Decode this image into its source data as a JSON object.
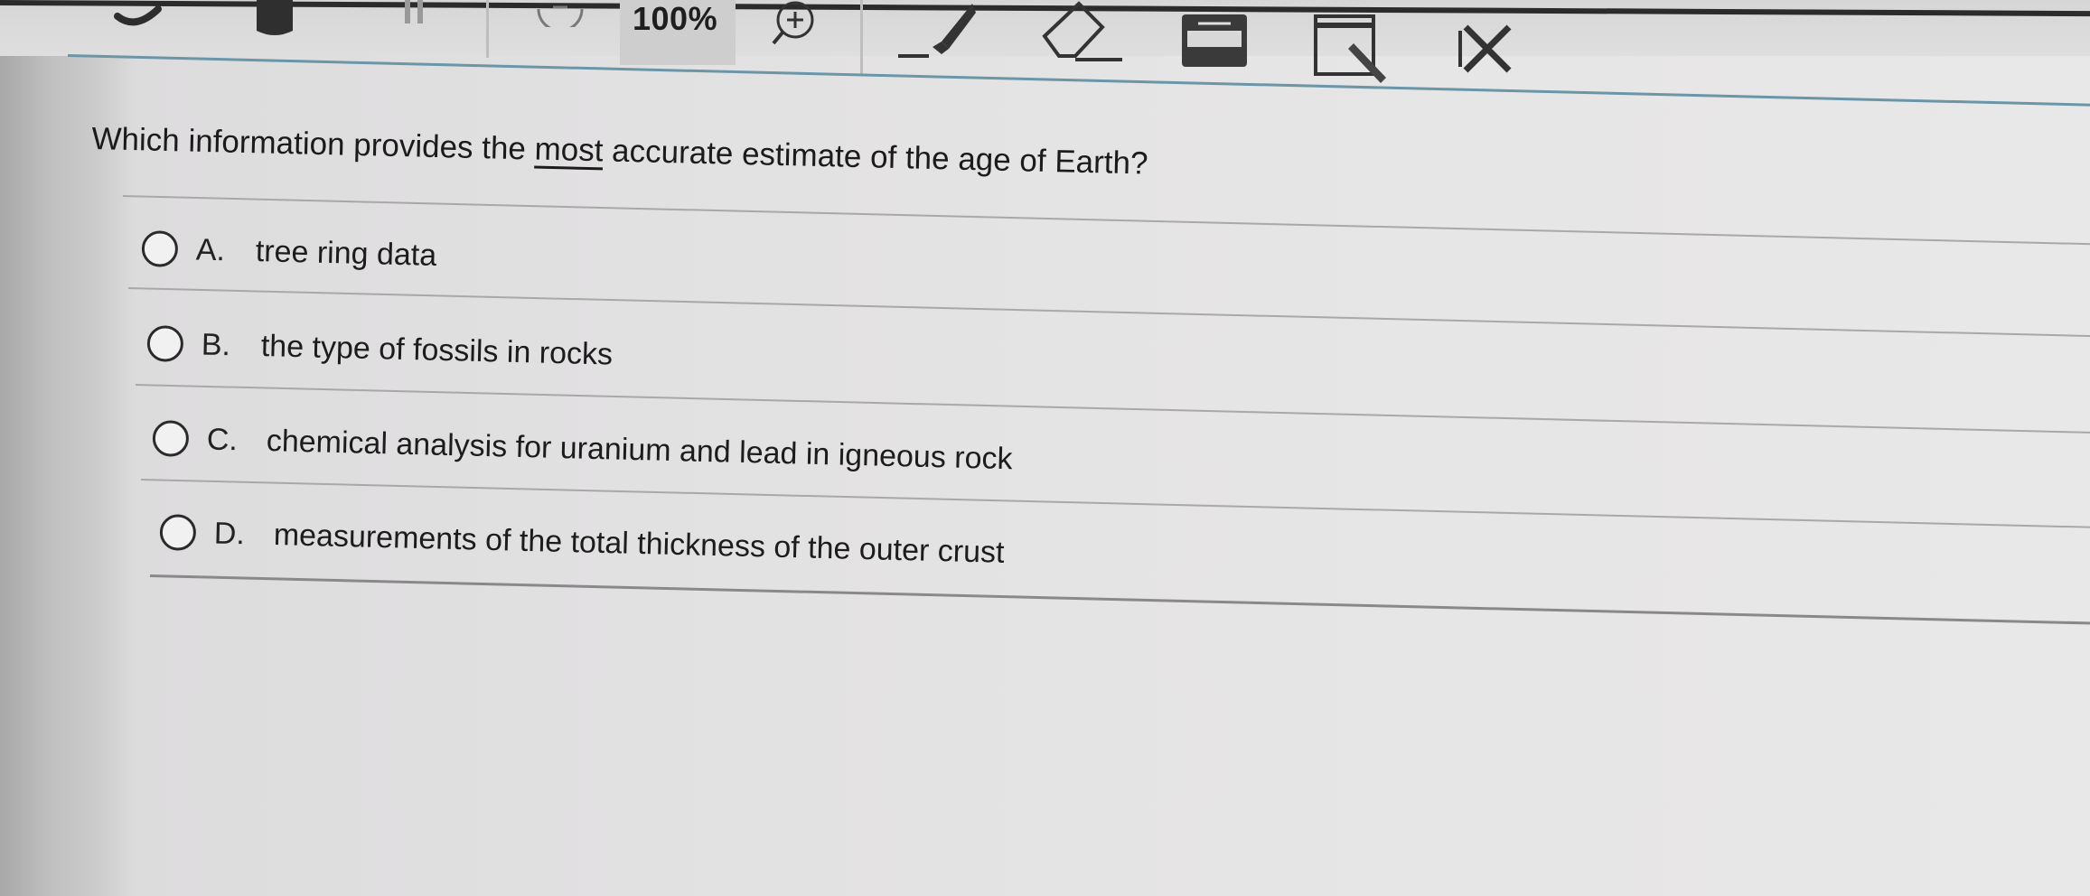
{
  "toolbar": {
    "zoom_level": "100%",
    "tools": [
      {
        "name": "undo-icon"
      },
      {
        "name": "bookmark-icon"
      },
      {
        "name": "pause-icon"
      },
      {
        "name": "zoom-out-icon"
      },
      {
        "name": "zoom-in-icon"
      },
      {
        "name": "highlighter-icon"
      },
      {
        "name": "eraser-icon"
      },
      {
        "name": "notepad-icon"
      },
      {
        "name": "line-reader-icon"
      },
      {
        "name": "answer-eliminator-icon"
      }
    ]
  },
  "question": {
    "prefix": "Which information provides the ",
    "emphasis": "most",
    "suffix": " accurate estimate of the age of Earth?"
  },
  "options": [
    {
      "letter": "A.",
      "text": "tree ring data"
    },
    {
      "letter": "B.",
      "text": "the type of fossils in rocks"
    },
    {
      "letter": "C.",
      "text": "chemical analysis for uranium and lead in igneous rock"
    },
    {
      "letter": "D.",
      "text": "measurements of the total thickness of the outer crust"
    }
  ],
  "colors": {
    "accent_rule": "#6a96a8",
    "text": "#1b1b1b",
    "background": "#e4e3e3"
  }
}
